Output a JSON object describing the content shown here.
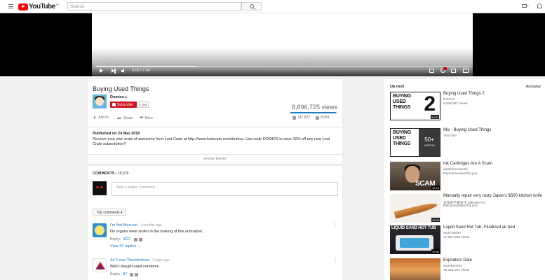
{
  "header": {
    "logo_text": "YouTube",
    "logo_country": "PT",
    "search_placeholder": "Search"
  },
  "player": {
    "time": "0:00 / 7:34",
    "progress": 0.0,
    "buffered": 0.27
  },
  "video": {
    "title": "Buying Used Things",
    "channel": "Domics",
    "subscribe_label": "Subscribe",
    "subscriber_count": "5.9M",
    "views": "8,896,725 views",
    "likes": "247,822",
    "dislikes": "8,964",
    "like_ratio": 0.965,
    "actions": {
      "add": "Add to",
      "share": "Share",
      "more": "More"
    }
  },
  "description": {
    "published": "Published on 24 Mar 2018",
    "text": "Receive your own crate of awesome from Loot Crate at http://www.lootcrate.com/domics. Use code DOMICS to save 10% off any new Loot Crate subscription!!",
    "show_more": "SHOW MORE"
  },
  "comments": {
    "label": "COMMENTS",
    "count": "15,376",
    "placeholder": "Add a public comment...",
    "sort_label": "Top comments",
    "items": [
      {
        "author": "I'm Not Mexican",
        "ago": "4 months ago",
        "text": "No organs were stolen in the making of this animation.",
        "reply": "Reply",
        "likes": "4221",
        "replies": "View 52 replies"
      },
      {
        "author": "Air Force Thunderbirds",
        "ago": "2 days ago",
        "text": "Well I bought used condoms.",
        "reply": "Reply",
        "likes": "87"
      }
    ]
  },
  "sidebar": {
    "up_next": "Up next",
    "autoplay": "Autoplay",
    "items": [
      {
        "title": "Buying Used Things 2",
        "channel": "Domics",
        "meta": "5,832,547 views",
        "duration": "10:37",
        "thumb_text": "BUYING USED THINGS",
        "thumb_big": "2"
      },
      {
        "title": "Mix - Buying Used Things",
        "channel": "YouTube",
        "meta": "",
        "thumb_text": "BUYING USED THINGS",
        "mix_count": "50+",
        "mix_label": "VIDEOS"
      },
      {
        "title": "Ink Cartridges Are A Scam",
        "channel": "austinmcconnell",
        "meta": "Recommended for you",
        "duration": "12:15",
        "thumb_text": "SCAM"
      },
      {
        "title": "Manually repair very rusty Japan's $500 kitchen knife",
        "channel": "五金的不是金卡 @Knife小A/",
        "meta": "Recommended for you",
        "duration": "12:29"
      },
      {
        "title": "Liquid Sand Hot Tub- Fluidized air bed",
        "channel": "Mark Rober",
        "meta": "27,867,808 views",
        "duration": "10:55",
        "thumb_text": "LIQUID SAND HOT TUB"
      },
      {
        "title": "Expiration Date",
        "channel": "teamfortress",
        "meta": "19,214,341 views"
      }
    ]
  },
  "colors": {
    "brand_red": "#ff0000",
    "subscribe_red": "#cc181e",
    "link_blue": "#167ac6"
  },
  "icons": [
    "menu-icon",
    "search-icon",
    "video-camera-icon",
    "bell-icon",
    "play-icon",
    "next-icon",
    "volume-icon",
    "captions-icon",
    "settings-icon",
    "miniplayer-icon",
    "theater-icon",
    "fullscreen-icon",
    "add-icon",
    "share-icon",
    "more-icon",
    "like-icon",
    "dislike-icon",
    "chevron-down-icon",
    "more-vertical-icon"
  ]
}
